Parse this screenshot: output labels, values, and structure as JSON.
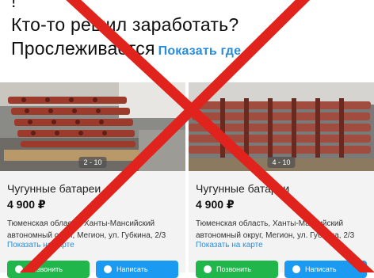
{
  "heading": {
    "line1": "!",
    "line2": "Кто-то решил заработать?",
    "line3": "Прослеживается",
    "show_link": "Показать где"
  },
  "cards": [
    {
      "counter": "2 - 10",
      "title": "Чугунные батареи",
      "price": "4 900 ₽",
      "address": "Тюменская область, Ханты-Мансийский автономный округ, Мегион, ул. Губкина, 2/3",
      "map_link": "Показать на карте",
      "call_label": "Позвонить",
      "write_label": "Написать"
    },
    {
      "counter": "4 - 10",
      "title": "Чугунные батареи",
      "price": "4 900 ₽",
      "address": "Тюменская область, Ханты-Мансийский автономный округ, Мегион, ул. Губкина, 2/3",
      "map_link": "Показать на карте",
      "call_label": "Позвонить",
      "write_label": "Написать"
    }
  ],
  "colors": {
    "cross": "#e0231c",
    "link": "#2a8ddb",
    "call_button": "#21b64c",
    "write_button": "#1a9bf1"
  }
}
